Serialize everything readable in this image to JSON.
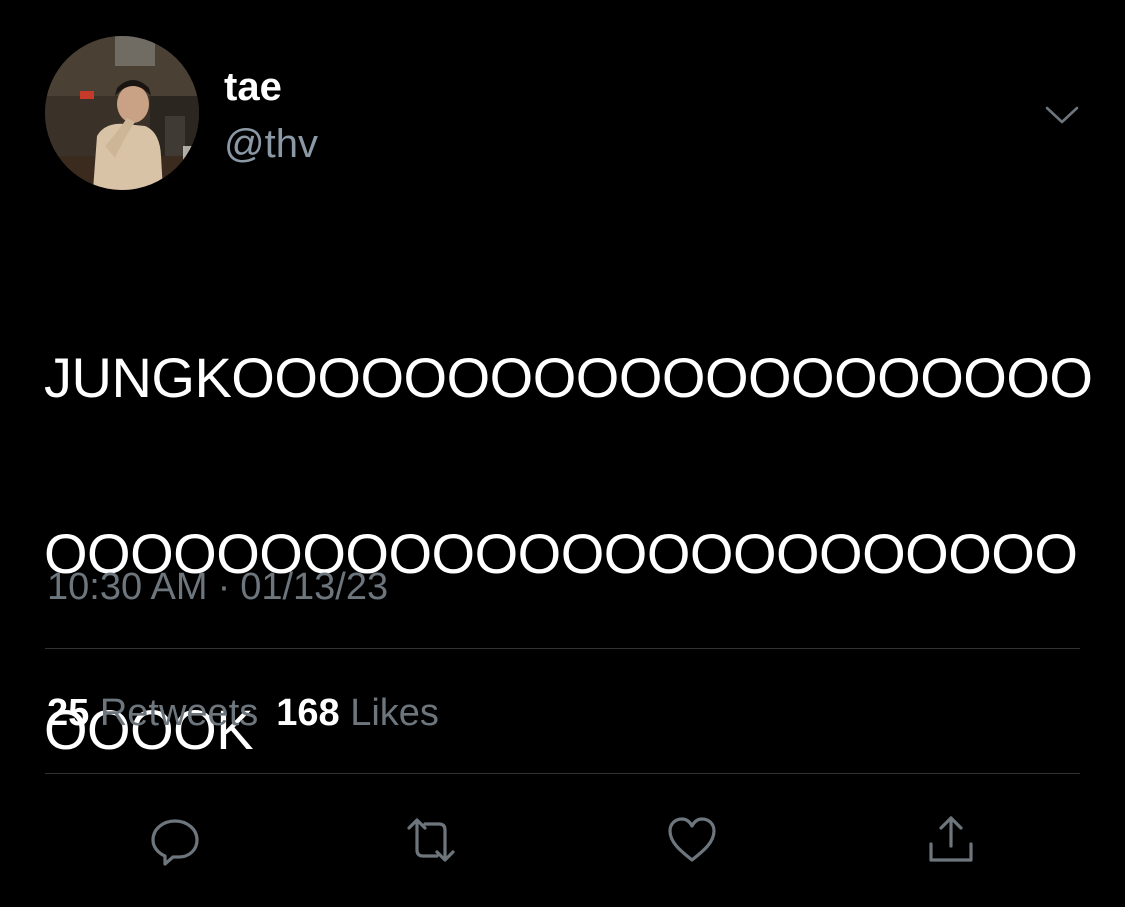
{
  "author": {
    "display_name": "tae",
    "handle": "@thv",
    "avatar_icon": "profile-photo"
  },
  "tweet": {
    "text_lines": [
      "JUNGKOOOOOOOOOOOOOOOOOOOO",
      "OOOOOOOOOOOOOOOOOOOOOOOO",
      "OOOOK"
    ],
    "time": "10:30 AM",
    "separator": "·",
    "date": "01/13/23"
  },
  "stats": {
    "retweets_count": "25",
    "retweets_label": "Retweets",
    "likes_count": "168",
    "likes_label": "Likes"
  },
  "actions": {
    "reply_icon": "reply-icon",
    "retweet_icon": "retweet-icon",
    "like_icon": "heart-icon",
    "share_icon": "share-icon"
  },
  "colors": {
    "background": "#000000",
    "primary_text": "#ffffff",
    "secondary_text": "#6e767d",
    "divider": "#2f3336"
  }
}
